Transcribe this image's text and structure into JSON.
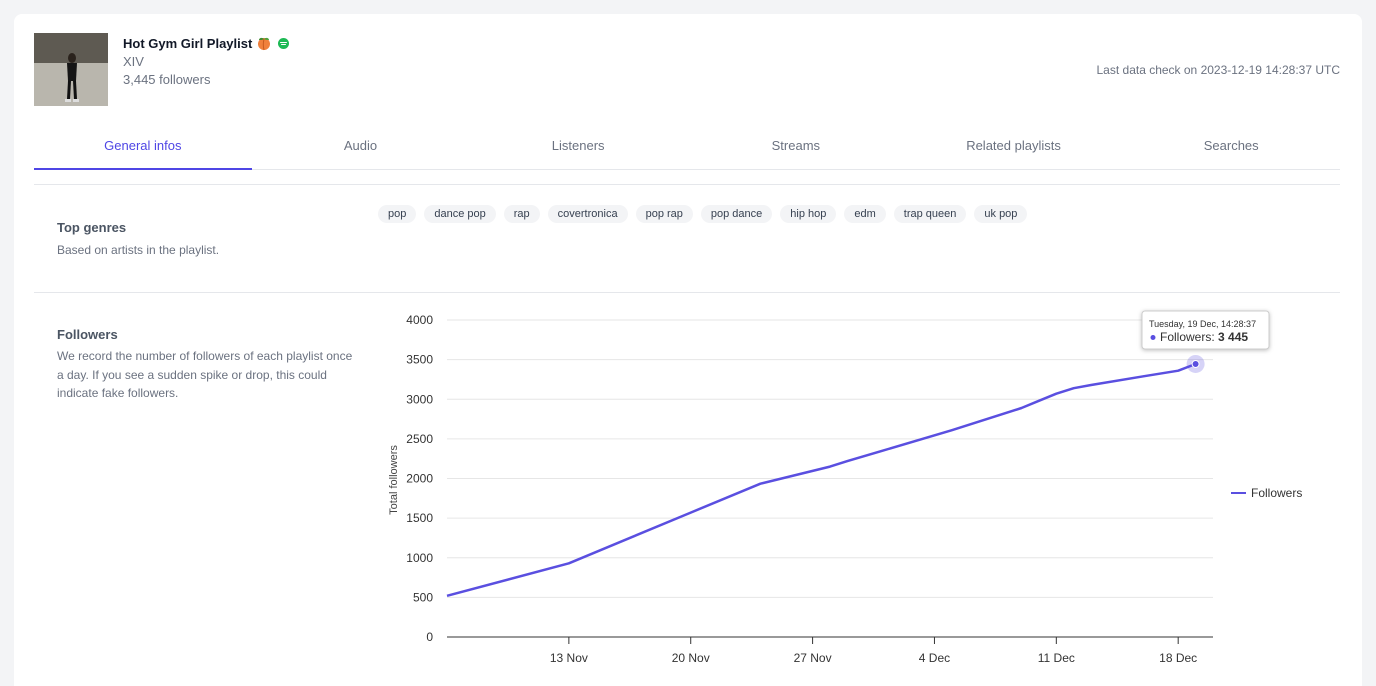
{
  "playlist": {
    "title": "Hot Gym Girl Playlist",
    "owner": "XIV",
    "followers": "3,445 followers",
    "badge_icon": "peach-icon",
    "platform_icon": "spotify-icon"
  },
  "last_check": "Last data check on 2023-12-19 14:28:37 UTC",
  "tabs": [
    {
      "label": "General infos",
      "active": true
    },
    {
      "label": "Audio"
    },
    {
      "label": "Listeners"
    },
    {
      "label": "Streams"
    },
    {
      "label": "Related playlists"
    },
    {
      "label": "Searches"
    }
  ],
  "top_genres": {
    "title": "Top genres",
    "description": "Based on artists in the playlist.",
    "tags": [
      "pop",
      "dance pop",
      "rap",
      "covertronica",
      "pop rap",
      "pop dance",
      "hip hop",
      "edm",
      "trap queen",
      "uk pop"
    ]
  },
  "followers_section": {
    "title": "Followers",
    "description_lines": [
      "We record the number of followers of each playlist once",
      "a day. If you see a sudden spike or drop, this could",
      "indicate fake followers."
    ]
  },
  "tooltip": {
    "date": "Tuesday, 19 Dec, 14:28:37",
    "label": "Followers: ",
    "value": "3 445"
  },
  "colors": {
    "accent": "#4f46e5",
    "line": "#5a4fe0",
    "spotify": "#1db954"
  },
  "chart_data": {
    "type": "line",
    "ylabel": "Total followers",
    "xlabel": "",
    "ylim": [
      0,
      4000
    ],
    "yticks": [
      0,
      500,
      1000,
      1500,
      2000,
      2500,
      3000,
      3500,
      4000
    ],
    "xlim": [
      "2023-11-06",
      "2023-12-20"
    ],
    "xticks": [
      {
        "date": "2023-11-13",
        "label": "13 Nov"
      },
      {
        "date": "2023-11-20",
        "label": "20 Nov"
      },
      {
        "date": "2023-11-27",
        "label": "27 Nov"
      },
      {
        "date": "2023-12-04",
        "label": "4 Dec"
      },
      {
        "date": "2023-12-11",
        "label": "11 Dec"
      },
      {
        "date": "2023-12-18",
        "label": "18 Dec"
      }
    ],
    "legend_position": "right",
    "series": [
      {
        "name": "Followers",
        "points": [
          {
            "x": "2023-11-06",
            "y": 520
          },
          {
            "x": "2023-11-13",
            "y": 930
          },
          {
            "x": "2023-11-20",
            "y": 1570
          },
          {
            "x": "2023-11-24",
            "y": 1935
          },
          {
            "x": "2023-11-28",
            "y": 2150
          },
          {
            "x": "2023-11-29",
            "y": 2220
          },
          {
            "x": "2023-12-01",
            "y": 2350
          },
          {
            "x": "2023-12-05",
            "y": 2610
          },
          {
            "x": "2023-12-09",
            "y": 2890
          },
          {
            "x": "2023-12-10",
            "y": 2980
          },
          {
            "x": "2023-12-11",
            "y": 3070
          },
          {
            "x": "2023-12-12",
            "y": 3140
          },
          {
            "x": "2023-12-13",
            "y": 3180
          },
          {
            "x": "2023-12-16",
            "y": 3290
          },
          {
            "x": "2023-12-18",
            "y": 3360
          },
          {
            "x": "2023-12-19",
            "y": 3445
          }
        ]
      }
    ]
  }
}
